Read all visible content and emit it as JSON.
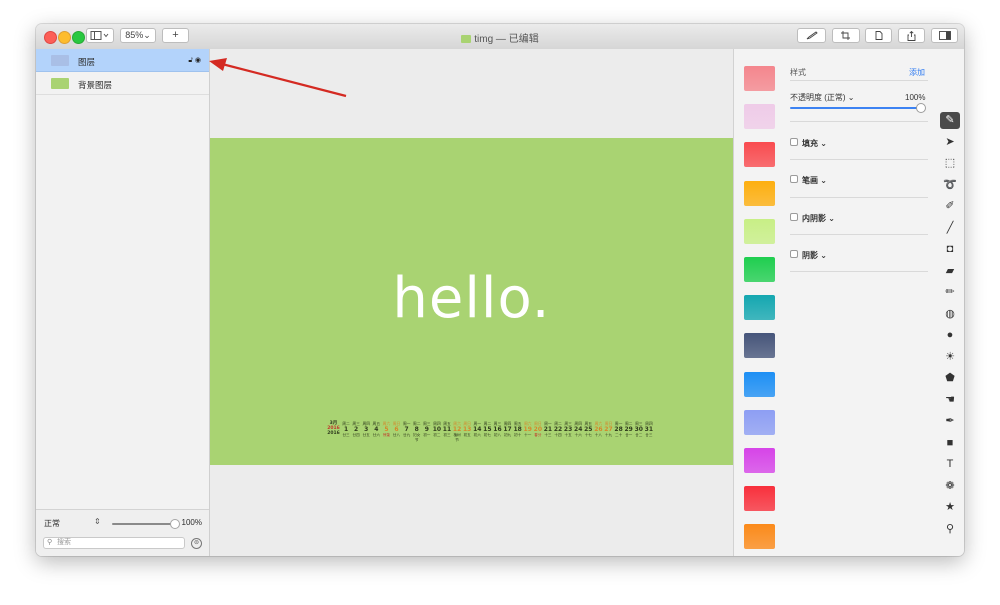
{
  "toolbar": {
    "zoom": "85%",
    "add_label": "+",
    "title": "timg — 已编辑"
  },
  "layers": [
    {
      "name": "图层",
      "thumb_color": "#a9bfe6",
      "selected": true
    },
    {
      "name": "背景图层",
      "thumb_color": "#a9d372",
      "selected": false
    }
  ],
  "sidebar_bottom": {
    "blend_mode": "正常",
    "opacity": "100%",
    "search_placeholder": "搜索"
  },
  "canvas": {
    "background": "#a9d372",
    "headline": "hello.",
    "calendar": {
      "month": "3月",
      "year_zh": "2016",
      "year": "2016",
      "days": [
        {
          "wd": "周二",
          "dn": "1",
          "ln": "廿三"
        },
        {
          "wd": "周三",
          "dn": "2",
          "ln": "廿四"
        },
        {
          "wd": "周四",
          "dn": "3",
          "ln": "廿五"
        },
        {
          "wd": "周五",
          "dn": "4",
          "ln": "廿六"
        },
        {
          "wd": "周六",
          "dn": "5",
          "ln": "惊蛰",
          "weekend": true,
          "holiday": true
        },
        {
          "wd": "周日",
          "dn": "6",
          "ln": "廿八",
          "weekend": true
        },
        {
          "wd": "周一",
          "dn": "7",
          "ln": "廿九"
        },
        {
          "wd": "周二",
          "dn": "8",
          "ln": "妇女节"
        },
        {
          "wd": "周三",
          "dn": "9",
          "ln": "初一"
        },
        {
          "wd": "周四",
          "dn": "10",
          "ln": "初二"
        },
        {
          "wd": "周五",
          "dn": "11",
          "ln": "初三"
        },
        {
          "wd": "周六",
          "dn": "12",
          "ln": "植树节",
          "weekend": true
        },
        {
          "wd": "周日",
          "dn": "13",
          "ln": "初五",
          "weekend": true
        },
        {
          "wd": "周一",
          "dn": "14",
          "ln": "初六"
        },
        {
          "wd": "周二",
          "dn": "15",
          "ln": "初七"
        },
        {
          "wd": "周三",
          "dn": "16",
          "ln": "初八"
        },
        {
          "wd": "周四",
          "dn": "17",
          "ln": "初九"
        },
        {
          "wd": "周五",
          "dn": "18",
          "ln": "初十"
        },
        {
          "wd": "周六",
          "dn": "19",
          "ln": "十一",
          "weekend": true
        },
        {
          "wd": "周日",
          "dn": "20",
          "ln": "春分",
          "weekend": true,
          "holiday": true
        },
        {
          "wd": "周一",
          "dn": "21",
          "ln": "十三"
        },
        {
          "wd": "周二",
          "dn": "22",
          "ln": "十四"
        },
        {
          "wd": "周三",
          "dn": "23",
          "ln": "十五"
        },
        {
          "wd": "周四",
          "dn": "24",
          "ln": "十六"
        },
        {
          "wd": "周五",
          "dn": "25",
          "ln": "十七"
        },
        {
          "wd": "周六",
          "dn": "26",
          "ln": "十八",
          "weekend": true
        },
        {
          "wd": "周日",
          "dn": "27",
          "ln": "十九",
          "weekend": true
        },
        {
          "wd": "周一",
          "dn": "28",
          "ln": "二十"
        },
        {
          "wd": "周二",
          "dn": "29",
          "ln": "廿一"
        },
        {
          "wd": "周三",
          "dn": "30",
          "ln": "廿二"
        },
        {
          "wd": "周四",
          "dn": "31",
          "ln": "廿三"
        }
      ]
    }
  },
  "styles_panel": {
    "styles_label": "样式",
    "add_label": "添加",
    "opacity_label": "不透明度 (正常) ⌄",
    "opacity_value": "100%",
    "sections": [
      "填充 ⌄",
      "笔画 ⌄",
      "内阴影 ⌄",
      "阴影 ⌄"
    ],
    "swatches": [
      "#f4868d",
      "#efcbe8",
      "#f94b4f",
      "#fdaf10",
      "#c8ef86",
      "#1fce4f",
      "#14a7b0",
      "#46557a",
      "#1d8ff4",
      "#8d9ef3",
      "#d644e8",
      "#f8303c",
      "#fb8a1a"
    ]
  },
  "tools": [
    {
      "name": "style-brush-icon",
      "glyph": "✎",
      "active": true
    },
    {
      "name": "arrow-pointer-icon",
      "glyph": "➤"
    },
    {
      "name": "rect-select-icon",
      "glyph": "⬚"
    },
    {
      "name": "lasso-icon",
      "glyph": "➰"
    },
    {
      "name": "quick-select-icon",
      "glyph": "✐"
    },
    {
      "name": "paint-brush-icon",
      "glyph": "╱"
    },
    {
      "name": "paint-bucket-icon",
      "glyph": "◘"
    },
    {
      "name": "eraser-icon",
      "glyph": "▰"
    },
    {
      "name": "pencil-icon",
      "glyph": "✏"
    },
    {
      "name": "clone-icon",
      "glyph": "◍"
    },
    {
      "name": "blur-icon",
      "glyph": "●"
    },
    {
      "name": "sun-icon",
      "glyph": "☀"
    },
    {
      "name": "shape-icon",
      "glyph": "⬟"
    },
    {
      "name": "smudge-icon",
      "glyph": "☚"
    },
    {
      "name": "pen-icon",
      "glyph": "✒"
    },
    {
      "name": "rounded-rect-icon",
      "glyph": "■"
    },
    {
      "name": "text-icon",
      "glyph": "T"
    },
    {
      "name": "color-adjust-icon",
      "glyph": "❁"
    },
    {
      "name": "star-icon",
      "glyph": "★"
    },
    {
      "name": "zoom-icon",
      "glyph": "⚲"
    }
  ],
  "colors": {
    "annotation_arrow": "#d42a22",
    "accent": "#2f7bf2",
    "selection": "#b3d3fb"
  }
}
